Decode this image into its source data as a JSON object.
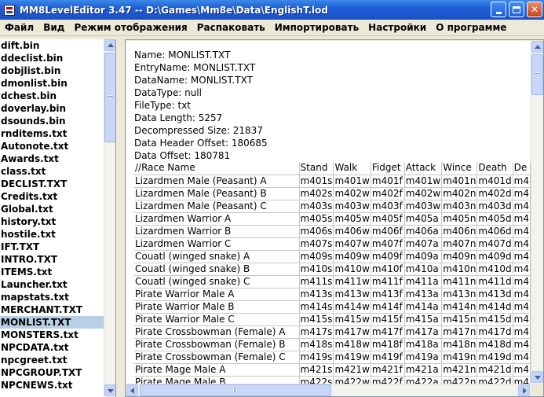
{
  "window": {
    "title": "MM8LevelEditor  3.47  -- D:\\Games\\Mm8e\\Data\\EnglishT.lod",
    "minimize_icon": "minimize-icon",
    "maximize_icon": "maximize-icon",
    "close_icon": "close-icon"
  },
  "menu": [
    "Файл",
    "Вид",
    "Режим отображения",
    "Распаковать",
    "Импортировать",
    "Настройки",
    "О программе"
  ],
  "files": {
    "items": [
      "dift.bin",
      "ddeclist.bin",
      "dobjlist.bin",
      "dmonlist.bin",
      "dchest.bin",
      "doverlay.bin",
      "dsounds.bin",
      "rnditems.txt",
      "Autonote.txt",
      "Awards.txt",
      "class.txt",
      "DECLIST.TXT",
      "Credits.txt",
      "Global.txt",
      "history.txt",
      "hostile.txt",
      "IFT.TXT",
      "INTRO.TXT",
      "ITEMS.txt",
      "Launcher.txt",
      "mapstats.txt",
      "MERCHANT.TXT",
      "MONLIST.TXT",
      "MONSTERS.txt",
      "NPCDATA.txt",
      "npcgreet.txt",
      "NPCGROUP.TXT",
      "NPCNEWS.txt"
    ],
    "selected": "MONLIST.TXT"
  },
  "info": [
    "Name: MONLIST.TXT",
    "EntryName: MONLIST.TXT",
    "DataName: MONLIST.TXT",
    "DataType: null",
    "FileType: txt",
    "Data Length: 5257",
    "Decompressed Size: 21837",
    "Data Header Offset: 180685",
    "Data Offset: 180781"
  ],
  "table": {
    "headers": [
      "//Race Name",
      "Stand",
      "Walk",
      "Fidget",
      "Attack",
      "Wince",
      "Death",
      "De"
    ],
    "rows": [
      [
        "Lizardmen Male (Peasant) A",
        "m401s",
        "m401w",
        "m401f",
        "m401w",
        "m401n",
        "m401d",
        "m4"
      ],
      [
        "Lizardmen Male (Peasant) B",
        "m402s",
        "m402w",
        "m402f",
        "m402w",
        "m402n",
        "m402d",
        "m4"
      ],
      [
        "Lizardmen Male (Peasant) C",
        "m403s",
        "m403w",
        "m403f",
        "m403w",
        "m403n",
        "m403d",
        "m4"
      ],
      [
        "Lizardmen Warrior A",
        "m405s",
        "m405w",
        "m405f",
        "m405a",
        "m405n",
        "m405d",
        "m4"
      ],
      [
        "Lizardmen Warrior B",
        "m406s",
        "m406w",
        "m406f",
        "m406a",
        "m406n",
        "m406d",
        "m4"
      ],
      [
        "Lizardmen Warrior C",
        "m407s",
        "m407w",
        "m407f",
        "m407a",
        "m407n",
        "m407d",
        "m4"
      ],
      [
        "Couatl (winged snake) A",
        "m409s",
        "m409w",
        "m409f",
        "m409a",
        "m409n",
        "m409d",
        "m4"
      ],
      [
        "Couatl (winged snake) B",
        "m410s",
        "m410w",
        "m410f",
        "m410a",
        "m410n",
        "m410d",
        "m4"
      ],
      [
        "Couatl (winged snake) C",
        "m411s",
        "m411w",
        "m411f",
        "m411a",
        "m411n",
        "m411d",
        "m4"
      ],
      [
        "Pirate Warrior Male A",
        "m413s",
        "m413w",
        "m413f",
        "m413a",
        "m413n",
        "m413d",
        "m4"
      ],
      [
        "Pirate Warrior Male B",
        "m414s",
        "m414w",
        "m414f",
        "m414a",
        "m414n",
        "m414d",
        "m4"
      ],
      [
        "Pirate Warrior Male C",
        "m415s",
        "m415w",
        "m415f",
        "m415a",
        "m415n",
        "m415d",
        "m4"
      ],
      [
        "Pirate Crossbowman (Female) A",
        "m417s",
        "m417w",
        "m417f",
        "m417a",
        "m417n",
        "m417d",
        "m4"
      ],
      [
        "Pirate Crossbowman (Female) B",
        "m418s",
        "m418w",
        "m418f",
        "m418a",
        "m418n",
        "m418d",
        "m4"
      ],
      [
        "Pirate Crossbowman (Female) C",
        "m419s",
        "m419w",
        "m419f",
        "m419a",
        "m419n",
        "m419d",
        "m4"
      ],
      [
        "Pirate Mage Male A",
        "m421s",
        "m421w",
        "m421f",
        "m421a",
        "m421n",
        "m421d",
        "m4"
      ],
      [
        "Pirate Mage Male B",
        "m422s",
        "m422w",
        "m422f",
        "m422a",
        "m422n",
        "m422d",
        "m4"
      ]
    ]
  },
  "icons": {
    "scroll_up": "arrow-up-icon",
    "scroll_down": "arrow-down-icon",
    "scroll_left": "arrow-left-icon",
    "scroll_right": "arrow-right-icon"
  },
  "colors": {
    "titlebar": "#1f5fd6",
    "selection": "#b8cfe5",
    "window_bg": "#ece9d8"
  }
}
